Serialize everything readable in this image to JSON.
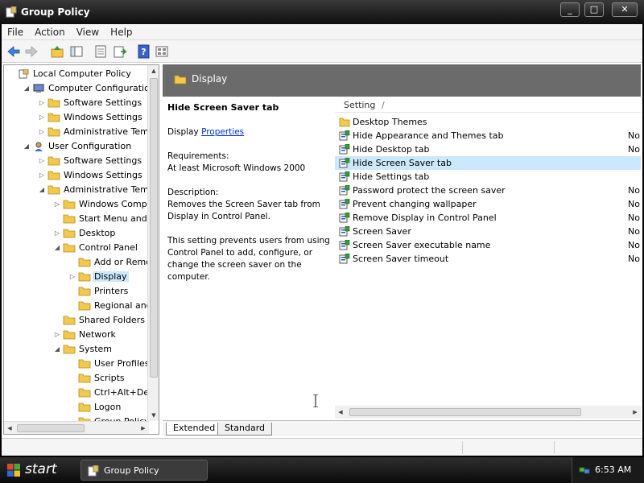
{
  "window": {
    "title": "Group Policy",
    "controls": {
      "minimize": "_",
      "maximize": "□",
      "close": "✕"
    }
  },
  "menu": {
    "items": [
      "File",
      "Action",
      "View",
      "Help"
    ]
  },
  "toolbar": {
    "buttons": [
      "back-icon",
      "forward-icon",
      "up-folder-icon",
      "show-hide-tree-icon",
      "export-list-icon",
      "properties-icon",
      "help-icon",
      "view-icon"
    ]
  },
  "tree": {
    "items": [
      {
        "label": "Local Computer Policy",
        "indent": 0,
        "expander": "",
        "icon": "policy"
      },
      {
        "label": "Computer Configuration",
        "indent": 1,
        "expander": "open",
        "icon": "computer"
      },
      {
        "label": "Software Settings",
        "indent": 2,
        "expander": "closed",
        "icon": "folder"
      },
      {
        "label": "Windows Settings",
        "indent": 2,
        "expander": "closed",
        "icon": "folder"
      },
      {
        "label": "Administrative Templat",
        "indent": 2,
        "expander": "closed",
        "icon": "folder"
      },
      {
        "label": "User Configuration",
        "indent": 1,
        "expander": "open",
        "icon": "user"
      },
      {
        "label": "Software Settings",
        "indent": 2,
        "expander": "closed",
        "icon": "folder"
      },
      {
        "label": "Windows Settings",
        "indent": 2,
        "expander": "closed",
        "icon": "folder"
      },
      {
        "label": "Administrative Templat",
        "indent": 2,
        "expander": "open",
        "icon": "folder"
      },
      {
        "label": "Windows Compone",
        "indent": 3,
        "expander": "closed",
        "icon": "folder"
      },
      {
        "label": "Start Menu and Tas",
        "indent": 3,
        "expander": "",
        "icon": "folder"
      },
      {
        "label": "Desktop",
        "indent": 3,
        "expander": "closed",
        "icon": "folder"
      },
      {
        "label": "Control Panel",
        "indent": 3,
        "expander": "open",
        "icon": "folder"
      },
      {
        "label": "Add or Remove",
        "indent": 4,
        "expander": "",
        "icon": "folder"
      },
      {
        "label": "Display",
        "indent": 4,
        "expander": "closed",
        "icon": "folder",
        "selected": true
      },
      {
        "label": "Printers",
        "indent": 4,
        "expander": "",
        "icon": "folder"
      },
      {
        "label": "Regional and La",
        "indent": 4,
        "expander": "",
        "icon": "folder"
      },
      {
        "label": "Shared Folders",
        "indent": 3,
        "expander": "",
        "icon": "folder"
      },
      {
        "label": "Network",
        "indent": 3,
        "expander": "closed",
        "icon": "folder"
      },
      {
        "label": "System",
        "indent": 3,
        "expander": "open",
        "icon": "folder"
      },
      {
        "label": "User Profiles",
        "indent": 4,
        "expander": "",
        "icon": "folder"
      },
      {
        "label": "Scripts",
        "indent": 4,
        "expander": "",
        "icon": "folder"
      },
      {
        "label": "Ctrl+Alt+Del C",
        "indent": 4,
        "expander": "",
        "icon": "folder"
      },
      {
        "label": "Logon",
        "indent": 4,
        "expander": "",
        "icon": "folder"
      },
      {
        "label": "Group Policy",
        "indent": 4,
        "expander": "",
        "icon": "folder"
      }
    ]
  },
  "rightpane": {
    "header": "Display",
    "description": {
      "heading": "Hide Screen Saver tab",
      "display_prefix": "Display",
      "properties_link": "Properties",
      "requirements_label": "Requirements:",
      "requirements_value": "At least Microsoft Windows 2000",
      "description_label": "Description:",
      "description_text": "Removes the Screen Saver tab from Display in Control Panel.",
      "detail_text": "This setting prevents users from using Control Panel to add, configure, or change the screen saver on the computer."
    },
    "columns": {
      "setting": "Setting",
      "separator": "/"
    },
    "settings": [
      {
        "label": "Desktop Themes",
        "icon": "folder",
        "state": ""
      },
      {
        "label": "Hide Appearance and Themes tab",
        "icon": "policy",
        "state": "No"
      },
      {
        "label": "Hide Desktop tab",
        "icon": "policy",
        "state": "No"
      },
      {
        "label": "Hide Screen Saver tab",
        "icon": "policy",
        "state": "",
        "selected": true
      },
      {
        "label": "Hide Settings tab",
        "icon": "policy",
        "state": ""
      },
      {
        "label": "Password protect the screen saver",
        "icon": "policy",
        "state": "No"
      },
      {
        "label": "Prevent changing wallpaper",
        "icon": "policy",
        "state": "No"
      },
      {
        "label": "Remove Display in Control Panel",
        "icon": "policy",
        "state": "No"
      },
      {
        "label": "Screen Saver",
        "icon": "policy",
        "state": "No"
      },
      {
        "label": "Screen Saver executable name",
        "icon": "policy",
        "state": "No"
      },
      {
        "label": "Screen Saver timeout",
        "icon": "policy",
        "state": "No"
      }
    ],
    "tabs": [
      "Extended",
      "Standard"
    ]
  },
  "taskbar": {
    "start_label": "start",
    "task_label": "Group Policy",
    "clock": "6:53 AM"
  },
  "colors": {
    "title_bar": "#1a1a1a",
    "header_band": "#6b6b6b",
    "selection": "#cce8ff",
    "link": "#0033cc",
    "folder": "#f2c94c"
  }
}
